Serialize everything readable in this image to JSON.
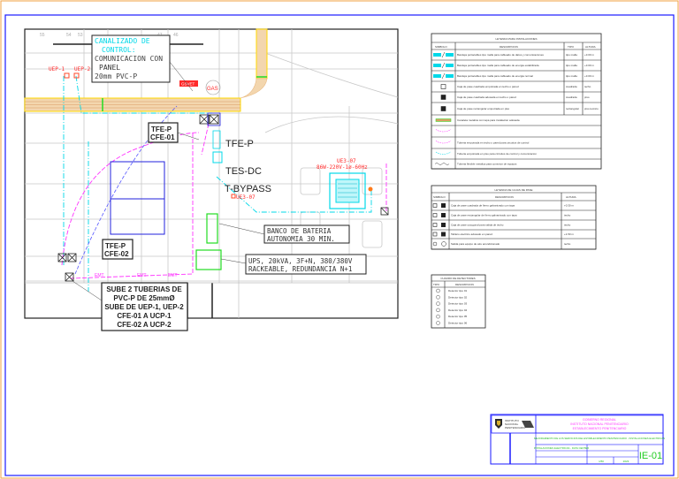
{
  "plan": {
    "note_control": [
      "CANALIZADO DE",
      "CONTROL:",
      "COMUNICACION CON",
      "PANEL",
      "20mm PVC-P"
    ],
    "uep1": "UEP-1",
    "uep2": "UEP-2",
    "gas": "GAS",
    "gas_tag": "GSVET",
    "tfe_cfe01": [
      "TFE-P",
      "CFE-01"
    ],
    "tfe_cfe02": [
      "TFE-P",
      "CFE-02"
    ],
    "tfe_p": "TFE-P",
    "tes_dc": "TES-DC",
    "t_bypass": "T-BYPASS",
    "ue3_07": "UE3-07",
    "ue3_07_spec": [
      "UE3-07",
      "86W-220V-1ø-60Hz"
    ],
    "battery_note": [
      "BANCO DE BATERIA",
      "AUTONOMIA 30 MIN."
    ],
    "ups_note": [
      "UPS, 20kVA, 3F+N, 380/380V",
      "RACKEABLE, REDUNDANCIA N+1"
    ],
    "tubes_note": [
      "SUBE 2 TUBERIAS DE",
      "PVC-P DE 25mmØ",
      "SUBE DE UEP-1, UEP-2",
      "CFE-01 A UCP-1",
      "CFE-02 A UCP-2"
    ],
    "emt": "EMT",
    "column_numbers": [
      "55",
      "54",
      "53",
      "52",
      "47",
      "46",
      "45"
    ]
  },
  "legend_main": {
    "title": "LEYENDA PARA INSTALACIONES",
    "headers": [
      "SIMBOLO",
      "DESCRIPCION",
      "TIPO",
      "ALTURA"
    ],
    "rows": [
      {
        "desc": "Bandeja portacables tipo malla para cableado de datos y comunicaciones",
        "tipo": "tipo malla",
        "alt": "+3.00 m"
      },
      {
        "desc": "Bandeja portacables tipo malla para cableado de energia estabilizada",
        "tipo": "tipo malla",
        "alt": "+3.00 m"
      },
      {
        "desc": "Bandeja portacables tipo malla para cableado de energia normal",
        "tipo": "tipo malla",
        "alt": "+3.00 m"
      },
      {
        "desc": "Caja de pase cuadrada empotrada en techo o pared",
        "tipo": "cuadrada",
        "alt": "techo"
      },
      {
        "desc": "Caja de pase cuadrada adosada en techo o pared",
        "tipo": "cuadrada",
        "alt": "piso"
      },
      {
        "desc": "Caja de pase rectangular empotrada en piso",
        "tipo": "rectangular",
        "alt": "piso tecnico"
      },
      {
        "desc": "Canaleta metalica con tapa para instalacion adosada",
        "tipo": "",
        "alt": ""
      },
      {
        "desc": "",
        "tipo": "",
        "alt": ""
      },
      {
        "desc": "Tuberia empotrada en techo o pared para circuitos de control",
        "tipo": "",
        "alt": ""
      },
      {
        "desc": "Tuberia empotrada en piso para circuitos de control y comunicacion",
        "tipo": "",
        "alt": ""
      },
      {
        "desc": "Tuberia flexible metalica para conexion de equipos",
        "tipo": "",
        "alt": ""
      }
    ]
  },
  "legend_boxes": {
    "title": "LEYENDA DE CAJAS DE PASE",
    "headers": [
      "SIMBOLO",
      "DESCRIPCION",
      "ALTURA"
    ],
    "rows": [
      {
        "desc": "Caja de pase cuadrada de fierro galvanizado con tapa",
        "alt": "+0.30 m"
      },
      {
        "desc": "Caja de pase rectangular de fierro galvanizado con tapa",
        "alt": "techo"
      },
      {
        "desc": "Caja de pase octogonal para salida de techo",
        "alt": "techo"
      },
      {
        "desc": "Tablero electrico adosado en pared",
        "alt": "+1.50 m"
      },
      {
        "desc": "Salida para equipo de aire acondicionado",
        "alt": "techo"
      }
    ]
  },
  "legend_detectors": {
    "title": "CUADRO DE DETECTORES",
    "headers": [
      "TIPO",
      "DESCRIPCION"
    ],
    "rows": [
      "Detector tipo 01",
      "Detector tipo 02",
      "Detector tipo 03",
      "Detector tipo 04",
      "Detector tipo 05",
      "Detector tipo 06"
    ]
  },
  "title_block": {
    "org": [
      "INSTITUTO",
      "NACIONAL",
      "PENITENCIARIO"
    ],
    "title_lines": [
      "GOBIERNO REGIONAL",
      "INSTITUTO NACIONAL PENITENCIARIO",
      "ESTABLECIMIENTO PENITENCIARIO"
    ],
    "project": "MEJORAMIENTO DE LOS SERVICIOS DEL ESTABLECIMIENTO PENITENCIARIO - INSTALACIONES ELECTRICAS",
    "sheet_title": "INSTALACIONES ELECTRICAS - DATA CENTER",
    "scale": "1/50",
    "date": "2023",
    "sheet": "IE-01"
  },
  "colors": {
    "frame": "#1a1aff",
    "cyan": "#00d8e8",
    "magenta": "#ff33ff",
    "red": "#ff2a2a",
    "tray": "#d8a060",
    "green": "#22dd22",
    "blue": "#2222dd"
  }
}
